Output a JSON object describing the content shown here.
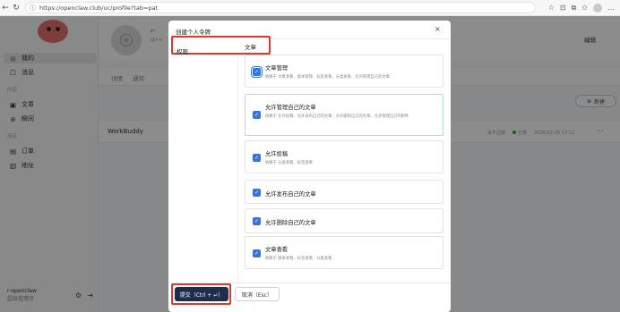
{
  "browser": {
    "url": "https://openclaw.club/uc/profile?tab=pat",
    "back_icon": "arrow-left",
    "refresh_icon": "refresh",
    "info_icon": "info-circle"
  },
  "sidebar": {
    "items": [
      {
        "label": "我的",
        "icon": "target-icon"
      },
      {
        "label": "消息",
        "icon": "message-icon"
      },
      {
        "label": "文章",
        "icon": "document-icon"
      },
      {
        "label": "瞬间",
        "icon": "moment-icon"
      },
      {
        "label": "订单",
        "icon": "order-icon"
      },
      {
        "label": "地址",
        "icon": "address-icon"
      }
    ],
    "groups": [
      "内容",
      "商店"
    ],
    "user_name": "r-openclaw",
    "user_role": "超级管理员"
  },
  "main": {
    "profile_name": "r-",
    "profile_sub": "@r-o",
    "edit_label": "编辑",
    "tabs": [
      "详情",
      "通知"
    ],
    "new_label": "新建",
    "token_name": "WorkBuddy",
    "token_expiry": "永不过期",
    "token_status": "正常",
    "token_date": "2026-02-25 17:12",
    "more_label": "···"
  },
  "modal": {
    "title": "创建个人令牌",
    "close_label": "×",
    "perm_header": "权限",
    "category": "文章",
    "permissions": [
      {
        "title": "文章管理",
        "desc": "依赖于 文章查看、版本管理、标签查看、分类查看、允许管理自己的文章",
        "checked": true
      },
      {
        "title": "允许管理自己的文章",
        "desc": "依赖于 允许投稿、允许发布自己的文章、允许删除自己的文章、允许管理自己的附件",
        "checked": true
      },
      {
        "title": "允许投稿",
        "desc": "依赖于 分类查看、标签查看",
        "checked": true
      },
      {
        "title": "允许发布自己的文章",
        "desc": "",
        "checked": true
      },
      {
        "title": "允许删除自己的文章",
        "desc": "",
        "checked": true
      },
      {
        "title": "文章查看",
        "desc": "依赖于 版本查看、标签查看、分类查看",
        "checked": true
      }
    ],
    "submit_label": "提交（Ctrl + ↵）",
    "cancel_label": "取消（Esc）"
  },
  "colors": {
    "primary": "#3b74d6",
    "submit_bg": "#1f2d4a",
    "highlight_red": "#e0362c"
  }
}
